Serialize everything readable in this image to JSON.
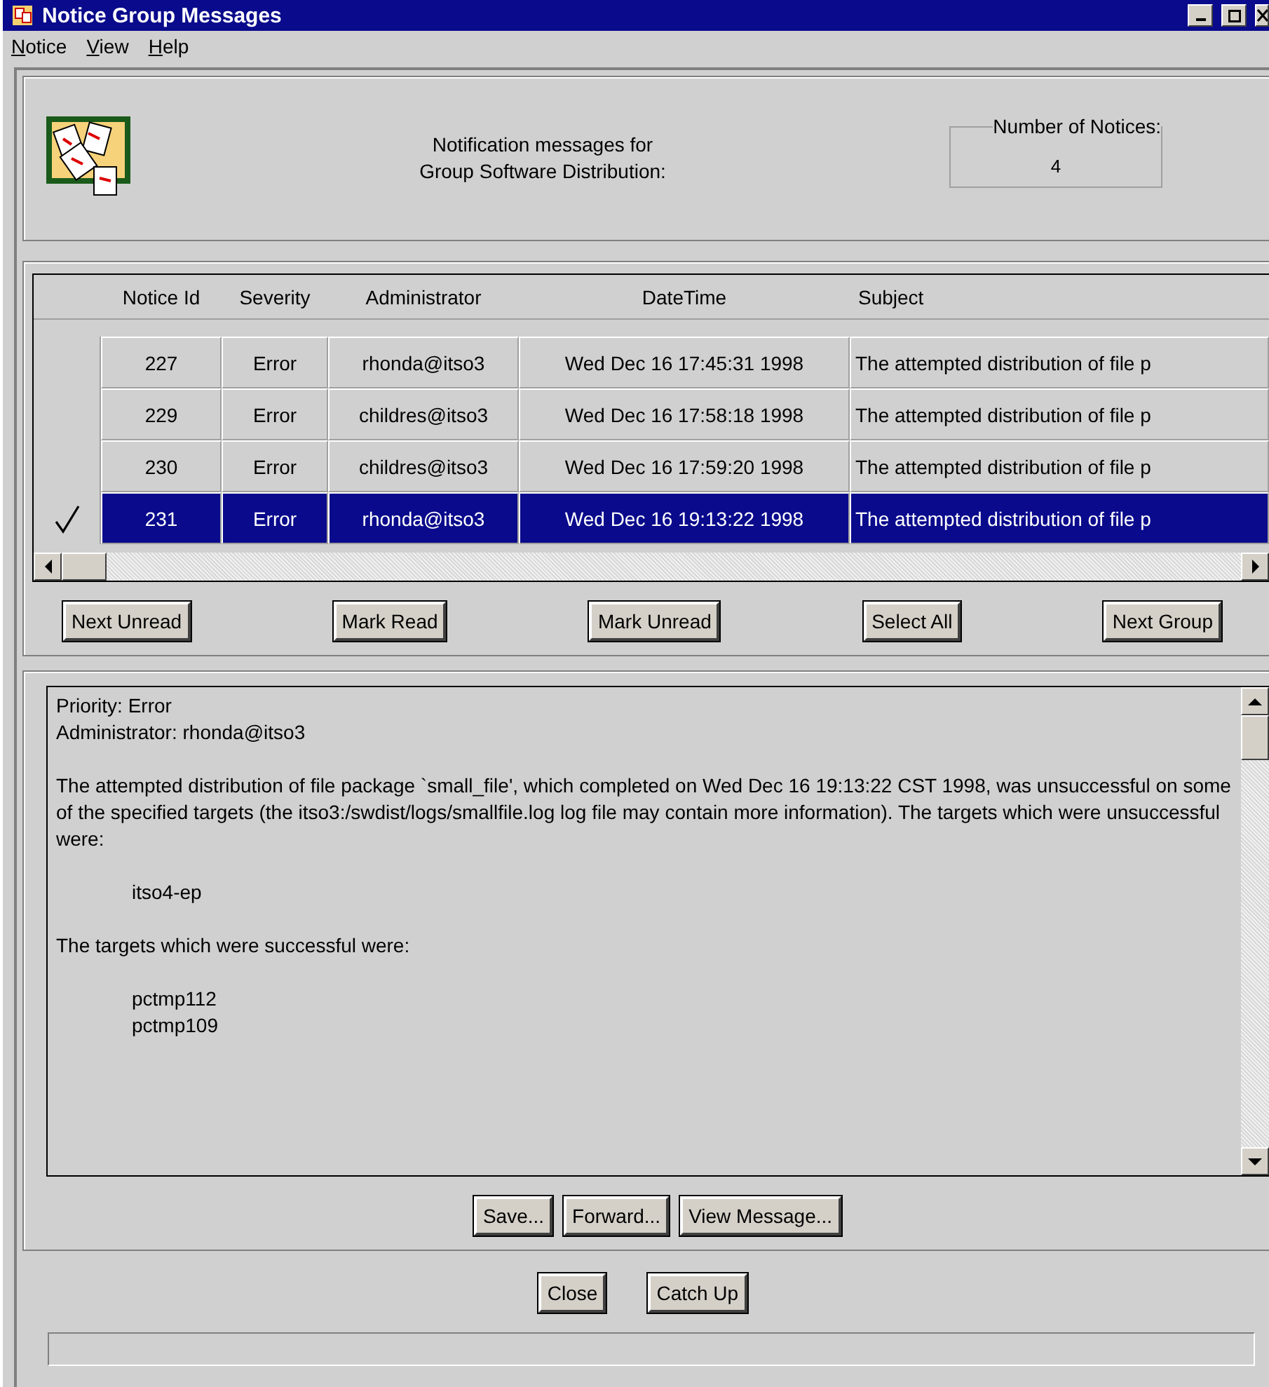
{
  "window": {
    "title": "Notice Group Messages"
  },
  "menu": [
    {
      "label": "Notice"
    },
    {
      "label": "View"
    },
    {
      "label": "Help"
    }
  ],
  "header": {
    "caption_line_1": "Notification messages for",
    "caption_line_2": "Group Software Distribution:",
    "count_label": "Number of Notices:",
    "count": "4"
  },
  "table": {
    "columns": [
      "Notice Id",
      "Severity",
      "Administrator",
      "DateTime",
      "Subject"
    ],
    "rows": [
      {
        "id": "227",
        "severity": "Error",
        "administrator": "rhonda@itso3",
        "datetime": "Wed Dec 16 17:45:31 1998",
        "subject": "The attempted distribution of file p",
        "selected": false,
        "checked": false
      },
      {
        "id": "229",
        "severity": "Error",
        "administrator": "childres@itso3",
        "datetime": "Wed Dec 16 17:58:18 1998",
        "subject": "The attempted distribution of file p",
        "selected": false,
        "checked": false
      },
      {
        "id": "230",
        "severity": "Error",
        "administrator": "childres@itso3",
        "datetime": "Wed Dec 16 17:59:20 1998",
        "subject": "The attempted distribution of file p",
        "selected": false,
        "checked": false
      },
      {
        "id": "231",
        "severity": "Error",
        "administrator": "rhonda@itso3",
        "datetime": "Wed Dec 16 19:13:22 1998",
        "subject": "The attempted distribution of file p",
        "selected": true,
        "checked": true
      }
    ]
  },
  "table_buttons": [
    "Next Unread",
    "Mark Read",
    "Mark Unread",
    "Select All",
    "Next Group"
  ],
  "message": {
    "lines": [
      {
        "kind": "text",
        "text": "Priority: Error"
      },
      {
        "kind": "text",
        "text": "Administrator: rhonda@itso3"
      },
      {
        "kind": "blank"
      },
      {
        "kind": "text",
        "text": "The attempted distribution of file package `small_file', which completed on Wed Dec 16 19:13:22 CST 1998, was unsuccessful on some of the specified targets (the itso3:/swdist/logs/smallfile.log log file may contain more information).  The targets which were unsuccessful were:"
      },
      {
        "kind": "blank"
      },
      {
        "kind": "indent",
        "text": "itso4-ep"
      },
      {
        "kind": "blank"
      },
      {
        "kind": "text",
        "text": "The targets which were successful were:"
      },
      {
        "kind": "blank"
      },
      {
        "kind": "indent",
        "text": "pctmp112"
      },
      {
        "kind": "indent",
        "text": "pctmp109"
      }
    ]
  },
  "message_buttons": [
    "Save...",
    "Forward...",
    "View Message..."
  ],
  "dialog_buttons": [
    "Close",
    "Catch Up"
  ]
}
